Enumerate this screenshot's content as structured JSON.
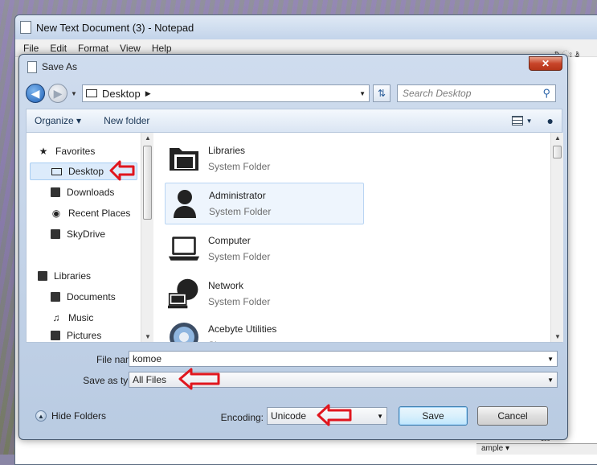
{
  "notepad": {
    "title": "New Text Document (3) - Notepad",
    "menu": [
      "File",
      "Edit",
      "Format",
      "View",
      "Help"
    ],
    "peek_text": "ರಿ.ಃ ತಿ",
    "ruler_text": "ample ▾",
    "ruler_num": "100"
  },
  "dialog": {
    "title": "Save As",
    "close_label": "✕",
    "address": {
      "location": "Desktop"
    },
    "search": {
      "placeholder": "Search Desktop"
    },
    "toolbar": {
      "organize": "Organize ▾",
      "new_folder": "New folder"
    },
    "nav": {
      "favorites_header": "Favorites",
      "favorites": [
        {
          "label": "Desktop",
          "icon": "desktop-icon",
          "selected": true
        },
        {
          "label": "Downloads",
          "icon": "downloads-icon"
        },
        {
          "label": "Recent Places",
          "icon": "recent-places-icon"
        },
        {
          "label": "SkyDrive",
          "icon": "skydrive-icon"
        }
      ],
      "libraries_header": "Libraries",
      "libraries": [
        {
          "label": "Documents",
          "icon": "documents-icon"
        },
        {
          "label": "Music",
          "icon": "music-icon"
        },
        {
          "label": "Pictures",
          "icon": "pictures-icon"
        }
      ]
    },
    "files": [
      {
        "name": "Libraries",
        "type": "System Folder"
      },
      {
        "name": "Administrator",
        "type": "System Folder"
      },
      {
        "name": "Computer",
        "type": "System Folder"
      },
      {
        "name": "Network",
        "type": "System Folder"
      },
      {
        "name": "Acebyte Utilities",
        "type": "Shortcut"
      }
    ],
    "form": {
      "file_name_label": "File name:",
      "file_name_value": "komoe",
      "save_type_label": "Save as type:",
      "save_type_value": "All Files",
      "encoding_label": "Encoding:",
      "encoding_value": "Unicode",
      "hide_folders": "Hide Folders",
      "save_button": "Save",
      "cancel_button": "Cancel"
    },
    "accent_color": "#e0161e"
  }
}
